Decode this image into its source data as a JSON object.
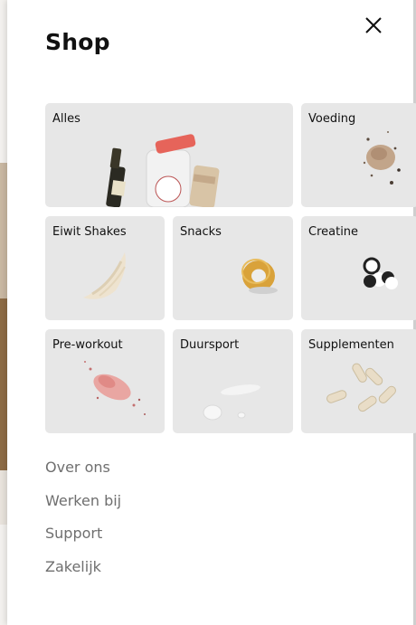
{
  "menu": {
    "title": "Shop",
    "close_icon": "close-icon"
  },
  "categories": [
    {
      "label": "Alles",
      "image": "product-bottles-image"
    },
    {
      "label": "Voeding",
      "image": "powder-pile-image"
    },
    {
      "label": "Eiwit Shakes",
      "image": "powder-swoosh-image"
    },
    {
      "label": "Snacks",
      "image": "snack-ring-image"
    },
    {
      "label": "Creatine",
      "image": "creatine-pills-image"
    },
    {
      "label": "Pre-workout",
      "image": "pink-powder-image"
    },
    {
      "label": "Duursport",
      "image": "gel-drops-image"
    },
    {
      "label": "Supplementen",
      "image": "capsules-image"
    }
  ],
  "links": [
    "Over ons",
    "Werken bij",
    "Support",
    "Zakelijk"
  ],
  "colors": {
    "tile_background": "#e7e7e7",
    "link_text": "#6f6f6f",
    "title_text": "#111111"
  }
}
